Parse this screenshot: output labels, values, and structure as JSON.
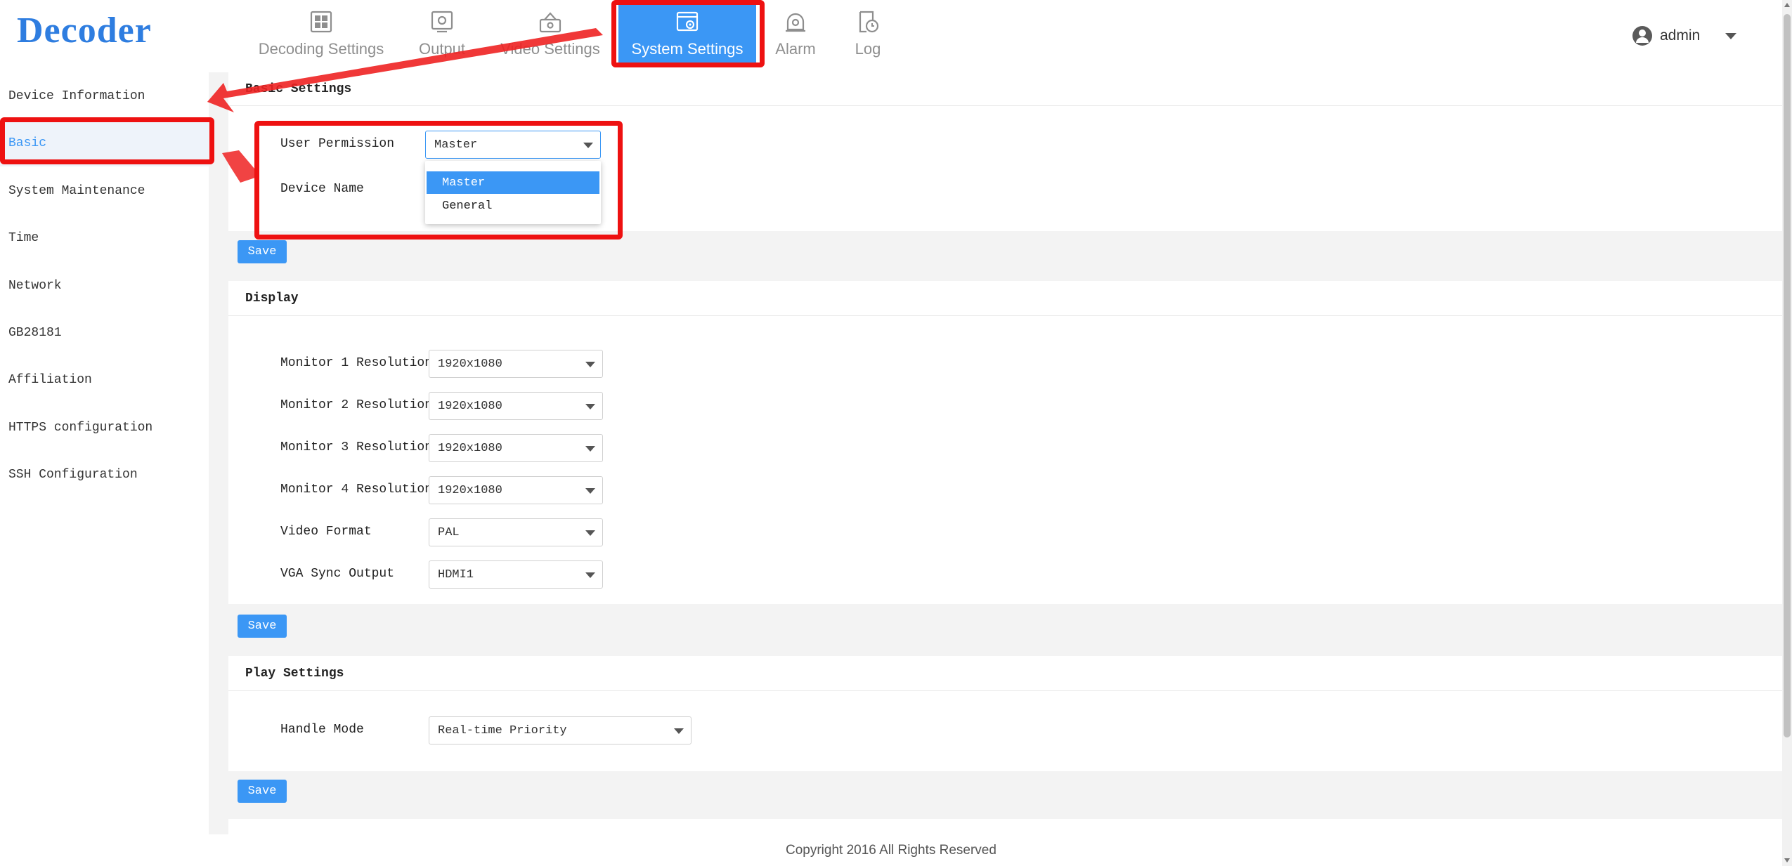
{
  "app": {
    "logo": "Decoder"
  },
  "nav": [
    {
      "label": "Decoding Settings",
      "icon": "grid-panel-icon"
    },
    {
      "label": "Output",
      "icon": "monitor-output-icon"
    },
    {
      "label": "Video Settings",
      "icon": "video-settings-icon"
    },
    {
      "label": "System Settings",
      "icon": "system-settings-icon",
      "active": true
    },
    {
      "label": "Alarm",
      "icon": "alarm-icon"
    },
    {
      "label": "Log",
      "icon": "log-clock-icon"
    }
  ],
  "user": {
    "name": "admin"
  },
  "sidebar": [
    {
      "label": "Device Information"
    },
    {
      "label": "Basic",
      "active": true
    },
    {
      "label": "System Maintenance"
    },
    {
      "label": "Time"
    },
    {
      "label": "Network"
    },
    {
      "label": "GB28181"
    },
    {
      "label": "Affiliation"
    },
    {
      "label": "HTTPS configuration"
    },
    {
      "label": "SSH Configuration"
    }
  ],
  "basic": {
    "title": "Basic Settings",
    "user_permission_label": "User Permission",
    "user_permission_value": "Master",
    "device_name_label": "Device Name",
    "options": [
      "Master",
      "General"
    ],
    "save": "Save"
  },
  "display": {
    "title": "Display",
    "fields": [
      {
        "label": "Monitor 1 Resolution",
        "value": "1920x1080"
      },
      {
        "label": "Monitor 2 Resolution",
        "value": "1920x1080"
      },
      {
        "label": "Monitor 3 Resolution",
        "value": "1920x1080"
      },
      {
        "label": "Monitor 4 Resolution",
        "value": "1920x1080"
      },
      {
        "label": "Video Format",
        "value": "PAL"
      },
      {
        "label": "VGA Sync Output",
        "value": "HDMI1"
      }
    ],
    "save": "Save"
  },
  "play": {
    "title": "Play Settings",
    "handle_mode_label": "Handle Mode",
    "handle_mode_value": "Real-time Priority",
    "save": "Save"
  },
  "footer": {
    "copyright": "Copyright 2016 All Rights Reserved"
  },
  "colors": {
    "accent": "#3b97f5",
    "annotation": "#ee1111",
    "logo": "#2e7de0"
  }
}
